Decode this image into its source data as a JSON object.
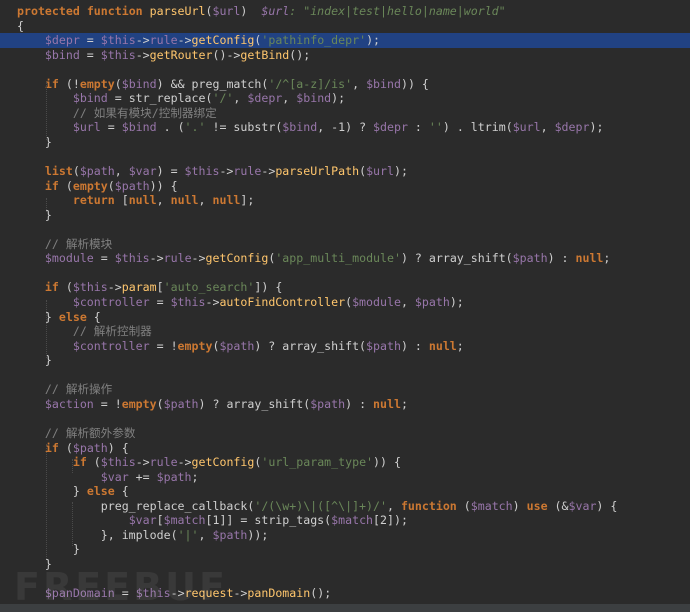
{
  "editor": {
    "colors": {
      "background": "#2b2b2b",
      "keyword": "#cc7832",
      "function": "#ffc66d",
      "variable": "#9876aa",
      "string": "#6a8759",
      "comment": "#808080",
      "selection_line": "#214283"
    },
    "lines": [
      [
        [
          "kw",
          "protected "
        ],
        [
          "kw",
          "function "
        ],
        [
          "fn",
          "parseUrl"
        ],
        [
          "op",
          "("
        ],
        [
          "var",
          "$url"
        ],
        [
          "op",
          ")  "
        ],
        [
          "hintvar",
          "$url"
        ],
        [
          "hint",
          ": \"index|test|hello|name|world\""
        ]
      ],
      [
        [
          "op",
          "{"
        ]
      ],
      [
        [
          "op",
          "    "
        ],
        [
          "var",
          "$depr"
        ],
        [
          "op",
          " = "
        ],
        [
          "var",
          "$this"
        ],
        [
          "op",
          "->"
        ],
        [
          "var",
          "rule"
        ],
        [
          "op",
          "->"
        ],
        [
          "fn",
          "getConfig"
        ],
        [
          "op",
          "("
        ],
        [
          "str",
          "'pathinfo_depr'"
        ],
        [
          "op",
          ");"
        ]
      ],
      [
        [
          "op",
          "    "
        ],
        [
          "var",
          "$bind"
        ],
        [
          "op",
          " = "
        ],
        [
          "var",
          "$this"
        ],
        [
          "op",
          "->"
        ],
        [
          "fn",
          "getRouter"
        ],
        [
          "op",
          "()->"
        ],
        [
          "fn",
          "getBind"
        ],
        [
          "op",
          "();"
        ]
      ],
      [],
      [
        [
          "op",
          "    "
        ],
        [
          "kw",
          "if "
        ],
        [
          "op",
          "(!"
        ],
        [
          "kw",
          "empty"
        ],
        [
          "op",
          "("
        ],
        [
          "var",
          "$bind"
        ],
        [
          "op",
          ") && "
        ],
        [
          "plain",
          "preg_match"
        ],
        [
          "op",
          "("
        ],
        [
          "str",
          "'/^[a-z]/is'"
        ],
        [
          "op",
          ", "
        ],
        [
          "var",
          "$bind"
        ],
        [
          "op",
          ")) {"
        ]
      ],
      [
        [
          "op",
          "        "
        ],
        [
          "var",
          "$bind"
        ],
        [
          "op",
          " = "
        ],
        [
          "plain",
          "str_replace"
        ],
        [
          "op",
          "("
        ],
        [
          "str",
          "'/'"
        ],
        [
          "op",
          ", "
        ],
        [
          "var",
          "$depr"
        ],
        [
          "op",
          ", "
        ],
        [
          "var",
          "$bind"
        ],
        [
          "op",
          ");"
        ]
      ],
      [
        [
          "op",
          "        "
        ],
        [
          "cmt",
          "// 如果有模块/控制器绑定"
        ]
      ],
      [
        [
          "op",
          "        "
        ],
        [
          "var",
          "$url"
        ],
        [
          "op",
          " = "
        ],
        [
          "var",
          "$bind"
        ],
        [
          "op",
          " . ("
        ],
        [
          "str",
          "'.'"
        ],
        [
          "op",
          " != "
        ],
        [
          "plain",
          "substr"
        ],
        [
          "op",
          "("
        ],
        [
          "var",
          "$bind"
        ],
        [
          "op",
          ", -1) ? "
        ],
        [
          "var",
          "$depr"
        ],
        [
          "op",
          " : "
        ],
        [
          "str",
          "''"
        ],
        [
          "op",
          ") . "
        ],
        [
          "plain",
          "ltrim"
        ],
        [
          "op",
          "("
        ],
        [
          "var",
          "$url"
        ],
        [
          "op",
          ", "
        ],
        [
          "var",
          "$depr"
        ],
        [
          "op",
          ");"
        ]
      ],
      [
        [
          "op",
          "    }"
        ]
      ],
      [],
      [
        [
          "op",
          "    "
        ],
        [
          "kw",
          "list"
        ],
        [
          "op",
          "("
        ],
        [
          "var",
          "$path"
        ],
        [
          "op",
          ", "
        ],
        [
          "var",
          "$var"
        ],
        [
          "op",
          ") = "
        ],
        [
          "var",
          "$this"
        ],
        [
          "op",
          "->"
        ],
        [
          "var",
          "rule"
        ],
        [
          "op",
          "->"
        ],
        [
          "fn",
          "parseUrlPath"
        ],
        [
          "op",
          "("
        ],
        [
          "var",
          "$url"
        ],
        [
          "op",
          ");"
        ]
      ],
      [
        [
          "op",
          "    "
        ],
        [
          "kw",
          "if "
        ],
        [
          "op",
          "("
        ],
        [
          "kw",
          "empty"
        ],
        [
          "op",
          "("
        ],
        [
          "var",
          "$path"
        ],
        [
          "op",
          ")) {"
        ]
      ],
      [
        [
          "op",
          "        "
        ],
        [
          "kw",
          "return "
        ],
        [
          "op",
          "["
        ],
        [
          "kw",
          "null"
        ],
        [
          "op",
          ", "
        ],
        [
          "kw",
          "null"
        ],
        [
          "op",
          ", "
        ],
        [
          "kw",
          "null"
        ],
        [
          "op",
          "];"
        ]
      ],
      [
        [
          "op",
          "    }"
        ]
      ],
      [],
      [
        [
          "op",
          "    "
        ],
        [
          "cmt",
          "// 解析模块"
        ]
      ],
      [
        [
          "op",
          "    "
        ],
        [
          "var",
          "$module"
        ],
        [
          "op",
          " = "
        ],
        [
          "var",
          "$this"
        ],
        [
          "op",
          "->"
        ],
        [
          "var",
          "rule"
        ],
        [
          "op",
          "->"
        ],
        [
          "fn",
          "getConfig"
        ],
        [
          "op",
          "("
        ],
        [
          "str",
          "'app_multi_module'"
        ],
        [
          "op",
          ") ? "
        ],
        [
          "plain",
          "array_shift"
        ],
        [
          "op",
          "("
        ],
        [
          "var",
          "$path"
        ],
        [
          "op",
          ") : "
        ],
        [
          "kw",
          "null"
        ],
        [
          "op",
          ";"
        ]
      ],
      [],
      [
        [
          "op",
          "    "
        ],
        [
          "kw",
          "if "
        ],
        [
          "op",
          "("
        ],
        [
          "var",
          "$this"
        ],
        [
          "op",
          "->"
        ],
        [
          "fn",
          "param"
        ],
        [
          "op",
          "["
        ],
        [
          "str",
          "'auto_search'"
        ],
        [
          "op",
          "]) {"
        ]
      ],
      [
        [
          "op",
          "        "
        ],
        [
          "var",
          "$controller"
        ],
        [
          "op",
          " = "
        ],
        [
          "var",
          "$this"
        ],
        [
          "op",
          "->"
        ],
        [
          "fn",
          "autoFindController"
        ],
        [
          "op",
          "("
        ],
        [
          "var",
          "$module"
        ],
        [
          "op",
          ", "
        ],
        [
          "var",
          "$path"
        ],
        [
          "op",
          ");"
        ]
      ],
      [
        [
          "op",
          "    } "
        ],
        [
          "kw",
          "else "
        ],
        [
          "op",
          "{"
        ]
      ],
      [
        [
          "op",
          "        "
        ],
        [
          "cmt",
          "// 解析控制器"
        ]
      ],
      [
        [
          "op",
          "        "
        ],
        [
          "var",
          "$controller"
        ],
        [
          "op",
          " = !"
        ],
        [
          "kw",
          "empty"
        ],
        [
          "op",
          "("
        ],
        [
          "var",
          "$path"
        ],
        [
          "op",
          ") ? "
        ],
        [
          "plain",
          "array_shift"
        ],
        [
          "op",
          "("
        ],
        [
          "var",
          "$path"
        ],
        [
          "op",
          ") : "
        ],
        [
          "kw",
          "null"
        ],
        [
          "op",
          ";"
        ]
      ],
      [
        [
          "op",
          "    }"
        ]
      ],
      [],
      [
        [
          "op",
          "    "
        ],
        [
          "cmt",
          "// 解析操作"
        ]
      ],
      [
        [
          "op",
          "    "
        ],
        [
          "var",
          "$action"
        ],
        [
          "op",
          " = !"
        ],
        [
          "kw",
          "empty"
        ],
        [
          "op",
          "("
        ],
        [
          "var",
          "$path"
        ],
        [
          "op",
          ") ? "
        ],
        [
          "plain",
          "array_shift"
        ],
        [
          "op",
          "("
        ],
        [
          "var",
          "$path"
        ],
        [
          "op",
          ") : "
        ],
        [
          "kw",
          "null"
        ],
        [
          "op",
          ";"
        ]
      ],
      [],
      [
        [
          "op",
          "    "
        ],
        [
          "cmt",
          "// 解析额外参数"
        ]
      ],
      [
        [
          "op",
          "    "
        ],
        [
          "kw",
          "if "
        ],
        [
          "op",
          "("
        ],
        [
          "var",
          "$path"
        ],
        [
          "op",
          ") {"
        ]
      ],
      [
        [
          "op",
          "        "
        ],
        [
          "kw",
          "if "
        ],
        [
          "op",
          "("
        ],
        [
          "var",
          "$this"
        ],
        [
          "op",
          "->"
        ],
        [
          "var",
          "rule"
        ],
        [
          "op",
          "->"
        ],
        [
          "fn",
          "getConfig"
        ],
        [
          "op",
          "("
        ],
        [
          "str",
          "'url_param_type'"
        ],
        [
          "op",
          ")) {"
        ]
      ],
      [
        [
          "op",
          "            "
        ],
        [
          "var",
          "$var"
        ],
        [
          "op",
          " += "
        ],
        [
          "var",
          "$path"
        ],
        [
          "op",
          ";"
        ]
      ],
      [
        [
          "op",
          "        } "
        ],
        [
          "kw",
          "else "
        ],
        [
          "op",
          "{"
        ]
      ],
      [
        [
          "op",
          "            "
        ],
        [
          "plain",
          "preg_replace_callback"
        ],
        [
          "op",
          "("
        ],
        [
          "str",
          "'/(\\w+)\\|([^\\|]+)/'"
        ],
        [
          "op",
          ", "
        ],
        [
          "kw",
          "function "
        ],
        [
          "op",
          "("
        ],
        [
          "var",
          "$match"
        ],
        [
          "op",
          ") "
        ],
        [
          "kw",
          "use "
        ],
        [
          "op",
          "(&"
        ],
        [
          "var",
          "$var"
        ],
        [
          "op",
          ") {"
        ]
      ],
      [
        [
          "op",
          "                "
        ],
        [
          "var",
          "$var"
        ],
        [
          "op",
          "["
        ],
        [
          "var",
          "$match"
        ],
        [
          "op",
          "[1]] = "
        ],
        [
          "plain",
          "strip_tags"
        ],
        [
          "op",
          "("
        ],
        [
          "var",
          "$match"
        ],
        [
          "op",
          "[2]);"
        ]
      ],
      [
        [
          "op",
          "            }, "
        ],
        [
          "plain",
          "implode"
        ],
        [
          "op",
          "("
        ],
        [
          "str",
          "'|'"
        ],
        [
          "op",
          ", "
        ],
        [
          "var",
          "$path"
        ],
        [
          "op",
          "));"
        ]
      ],
      [
        [
          "op",
          "        }"
        ]
      ],
      [
        [
          "op",
          "    }"
        ]
      ],
      [],
      [
        [
          "op",
          "    "
        ],
        [
          "var",
          "$panDomain"
        ],
        [
          "op",
          " = "
        ],
        [
          "var",
          "$this"
        ],
        [
          "op",
          "->"
        ],
        [
          "fn",
          "request"
        ],
        [
          "op",
          "->"
        ],
        [
          "fn",
          "panDomain"
        ],
        [
          "op",
          "();"
        ]
      ]
    ],
    "highlighted_line": 2,
    "watermark": "FREEBUF"
  }
}
